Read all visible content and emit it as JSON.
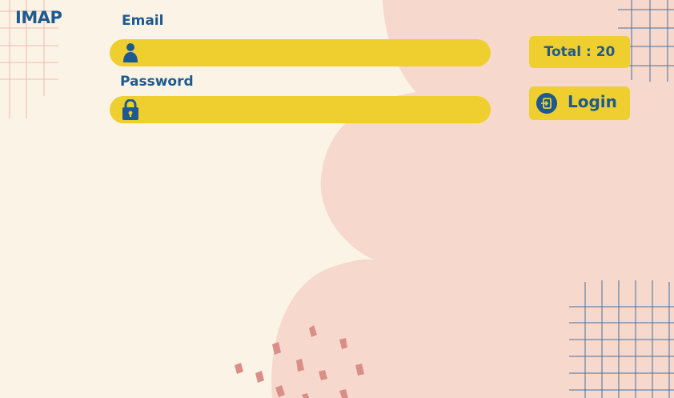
{
  "app": {
    "title": "IMAP"
  },
  "form": {
    "email_label": "Email",
    "email_value": "",
    "password_label": "Password",
    "password_value": ""
  },
  "stats": {
    "total_text": "Total : 20"
  },
  "actions": {
    "login_label": "Login"
  },
  "icons": {
    "email_field_icon": "user-icon",
    "password_field_icon": "lock-icon",
    "login_button_icon": "sign-in-icon"
  },
  "colors": {
    "background": "#FBF4E6",
    "blob": "#F6D8CD",
    "accent_yellow": "#EFCF2F",
    "text_blue": "#1E5A8F",
    "grid_pink": "#F2B7B0",
    "grid_blue": "#2E5F8F",
    "brush": "#D98E87"
  }
}
